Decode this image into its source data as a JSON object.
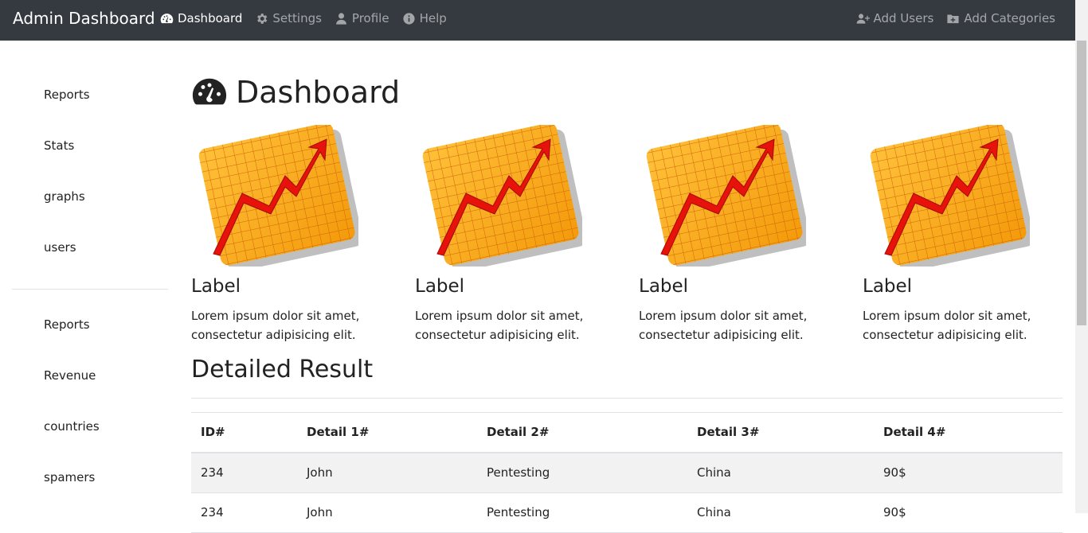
{
  "navbar": {
    "brand": "Admin Dashboard",
    "left_items": [
      {
        "label": "Dashboard",
        "icon": "tachometer-icon",
        "active": true
      },
      {
        "label": "Settings",
        "icon": "gear-icon"
      },
      {
        "label": "Profile",
        "icon": "user-icon"
      },
      {
        "label": "Help",
        "icon": "info-icon"
      }
    ],
    "right_items": [
      {
        "label": "Add Users",
        "icon": "user-plus-icon"
      },
      {
        "label": "Add Categories",
        "icon": "folder-plus-icon"
      }
    ]
  },
  "sidebar": {
    "group1": [
      "Reports",
      "Stats",
      "graphs",
      "users"
    ],
    "group2": [
      "Reports",
      "Revenue",
      "countries",
      "spamers"
    ]
  },
  "main": {
    "title": "Dashboard",
    "title_icon": "tachometer-icon",
    "cards": [
      {
        "label": "Label",
        "text": "Lorem ipsum dolor sit amet, consectetur adipisicing elit."
      },
      {
        "label": "Label",
        "text": "Lorem ipsum dolor sit amet, consectetur adipisicing elit."
      },
      {
        "label": "Label",
        "text": "Lorem ipsum dolor sit amet, consectetur adipisicing elit."
      },
      {
        "label": "Label",
        "text": "Lorem ipsum dolor sit amet, consectetur adipisicing elit."
      }
    ],
    "section_title": "Detailed Result",
    "table": {
      "headers": [
        "ID#",
        "Detail 1#",
        "Detail 2#",
        "Detail 3#",
        "Detail 4#"
      ],
      "rows": [
        [
          "234",
          "John",
          "Pentesting",
          "China",
          "90$"
        ],
        [
          "234",
          "John",
          "Pentesting",
          "China",
          "90$"
        ]
      ]
    }
  },
  "colors": {
    "navbar_bg": "#343a40",
    "chart_orange": "#f5a40a",
    "arrow_red": "#e8120c"
  }
}
